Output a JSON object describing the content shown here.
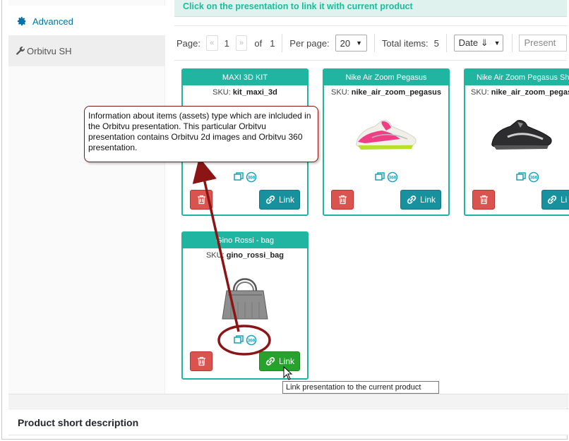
{
  "sidebar": {
    "items": [
      {
        "label": "Advanced",
        "icon": "gear-icon"
      },
      {
        "label": "Orbitvu SH",
        "icon": "wrench-icon"
      }
    ]
  },
  "notice": {
    "text": "Click on the presentation to link it with current product"
  },
  "pagination": {
    "page_label": "Page:",
    "prev": "«",
    "current_page": "1",
    "next": "»",
    "of_label": "of",
    "total_pages": "1",
    "per_page_label": "Per page:",
    "per_page_value": "20",
    "total_label": "Total items:",
    "total_items": "5",
    "sort_value": "Date ⇓",
    "search_placeholder": "Present"
  },
  "cards": [
    {
      "title": "MAXI 3D KIT",
      "sku_label": "SKU:",
      "sku": "kit_maxi_3d",
      "link_label": "Link"
    },
    {
      "title": "Nike Air Zoom Pegasus",
      "sku_label": "SKU:",
      "sku": "nike_air_zoom_pegasus",
      "link_label": "Link"
    },
    {
      "title": "Nike Air Zoom Pegasus Sh",
      "sku_label": "SKU:",
      "sku": "nike_air_zoom_pegasus",
      "link_label": "Li"
    },
    {
      "title": "Gino Rossi - bag",
      "sku_label": "SKU:",
      "sku": "gino_rossi_bag",
      "link_label": "Link"
    }
  ],
  "annotation": {
    "callout": "Information about items (assets) type which are inlcluded in the Orbitvu presentation. This particular Orbitvu presentation contains Orbitvu 2d images and Orbitvu 360 presentation."
  },
  "tooltip": "Link presentation to the current product",
  "product_short_description": "Product short description",
  "colors": {
    "teal": "#1fb5a1",
    "link": "#17919e",
    "danger": "#d9534f",
    "annotation": "#8b1515",
    "highlight": "#ffff33",
    "hover_link": "#27a22c"
  }
}
